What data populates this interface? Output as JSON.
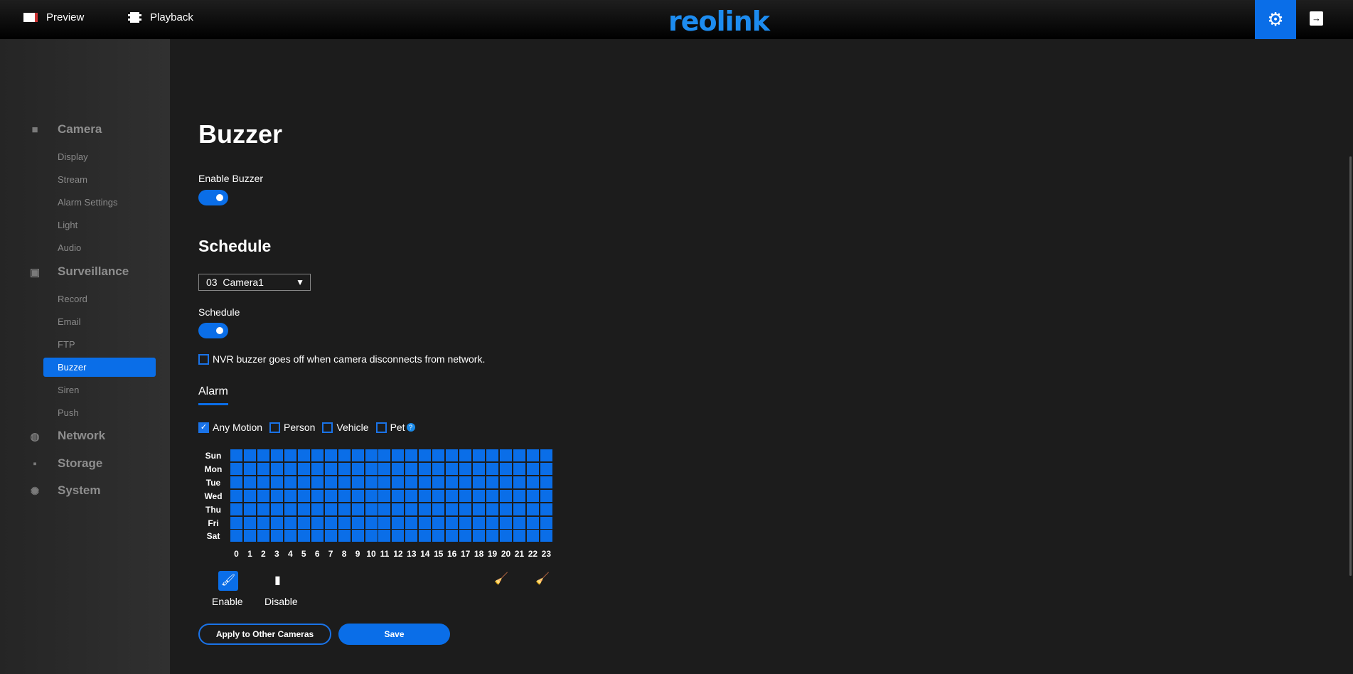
{
  "topbar": {
    "preview": "Preview",
    "playback": "Playback",
    "logo": "reolink",
    "icons": {
      "preview": "video-camera-icon",
      "playback": "film-icon",
      "settings": "gear-icon",
      "logout": "exit-icon"
    }
  },
  "sidebar": {
    "camera": {
      "label": "Camera",
      "items": [
        "Display",
        "Stream",
        "Alarm Settings",
        "Light",
        "Audio"
      ]
    },
    "surveillance": {
      "label": "Surveillance",
      "items": [
        "Record",
        "Email",
        "FTP",
        "Buzzer",
        "Siren",
        "Push"
      ]
    },
    "network": "Network",
    "storage": "Storage",
    "system": "System",
    "active": "Buzzer"
  },
  "main": {
    "title": "Buzzer",
    "enable_label": "Enable Buzzer",
    "enable_on": true,
    "schedule_heading": "Schedule",
    "camera_select": {
      "number": "03",
      "name": "Camera1"
    },
    "schedule_label": "Schedule",
    "schedule_on": true,
    "disconnect_label": "NVR buzzer goes off when camera disconnects from network.",
    "disconnect_checked": false,
    "tab": "Alarm",
    "types": [
      {
        "label": "Any Motion",
        "checked": true
      },
      {
        "label": "Person",
        "checked": false
      },
      {
        "label": "Vehicle",
        "checked": false
      },
      {
        "label": "Pet",
        "checked": false
      }
    ],
    "days": [
      "Sun",
      "Mon",
      "Tue",
      "Wed",
      "Thu",
      "Fri",
      "Sat"
    ],
    "hours": [
      "0",
      "1",
      "2",
      "3",
      "4",
      "5",
      "6",
      "7",
      "8",
      "9",
      "10",
      "11",
      "12",
      "13",
      "14",
      "15",
      "16",
      "17",
      "18",
      "19",
      "20",
      "21",
      "22",
      "23"
    ],
    "schedule_grid": [
      "111111111111111111111111",
      "111111111111111111111111",
      "111111111111111111111111",
      "111111111111111111111111",
      "111111111111111111111111",
      "111111111111111111111111",
      "111111111111111111111111"
    ],
    "active_color": "#0a6ee8",
    "tools": {
      "enable": "Enable",
      "disable": "Disable"
    },
    "apply_button": "Apply to Other Cameras",
    "save_button": "Save"
  }
}
